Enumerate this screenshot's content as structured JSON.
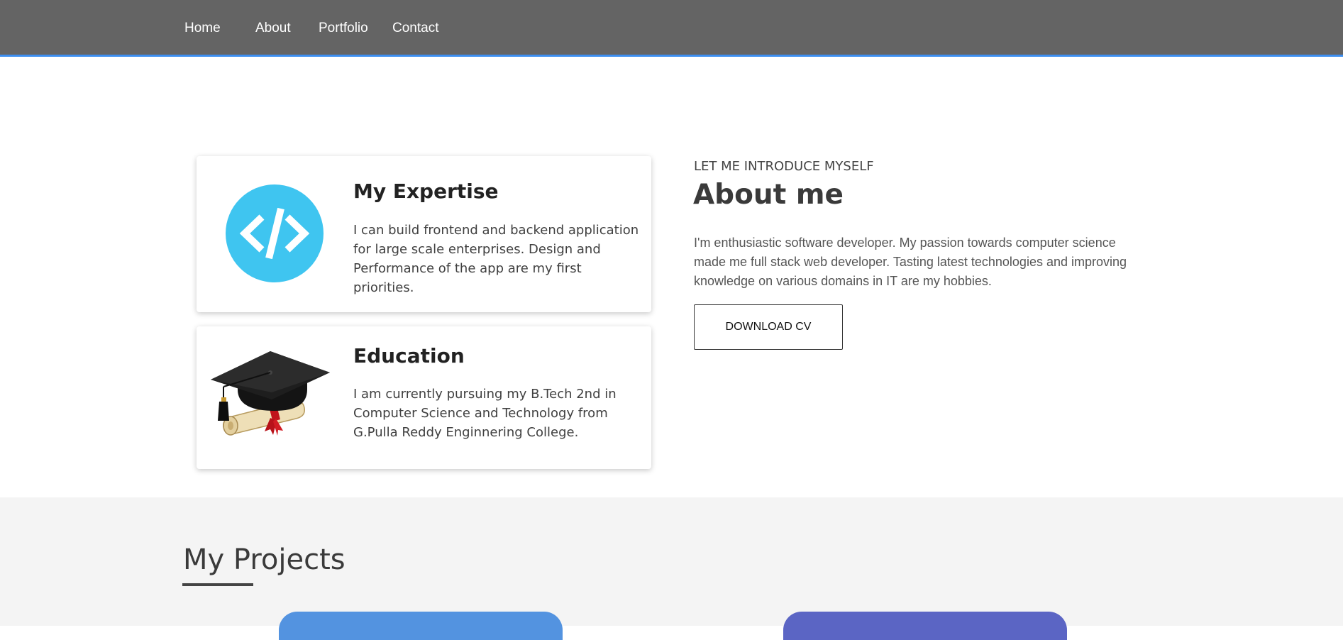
{
  "nav": {
    "items": [
      {
        "label": "Home"
      },
      {
        "label": "About"
      },
      {
        "label": "Portfolio"
      },
      {
        "label": "Contact"
      }
    ]
  },
  "cards": [
    {
      "title": "My Expertise",
      "text": "I can build frontend and backend application for large scale enterprises. Design and Performance of the app are my first priorities.",
      "icon": "code-icon",
      "icon_color": "#3fc5f0"
    },
    {
      "title": "Education",
      "text": "I am currently pursuing my B.Tech 2nd in Computer Science and Technology from G.Pulla Reddy Enginnering College.",
      "icon": "graduation-cap-icon"
    }
  ],
  "about": {
    "intro": "LET ME INTRODUCE MYSELF",
    "title": "About me",
    "text": "I'm enthusiastic software developer. My passion towards computer science made me full stack web developer. Tasting latest technologies and improving knowledge on various domains in IT are my hobbies.",
    "button_label": "DOWNLOAD CV"
  },
  "projects": {
    "title": "My Projects",
    "card_colors": [
      "#5393e0",
      "#5b65c4"
    ]
  },
  "colors": {
    "nav_bg": "#646464",
    "nav_border": "#3c8ef0",
    "section_bg": "#f4f4f4"
  }
}
